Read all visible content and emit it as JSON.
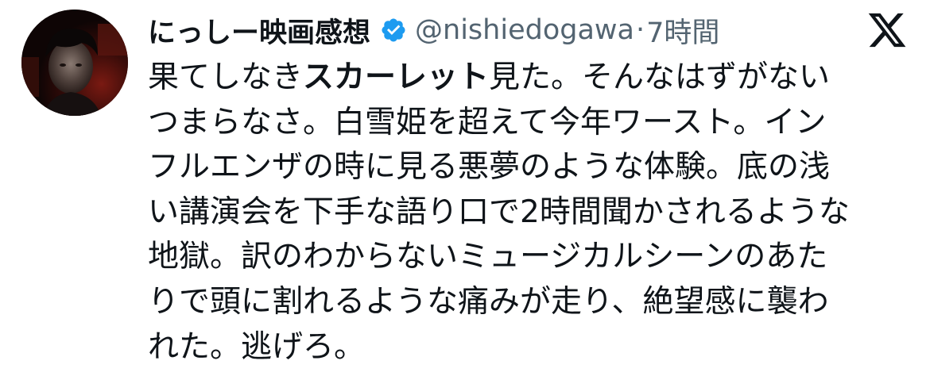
{
  "user": {
    "display_name": "にっしー映画感想",
    "handle": "@nishiedogawa",
    "separator": "·",
    "time": "7時間",
    "verified": true,
    "verified_color": "#1d9bf0"
  },
  "icons": {
    "avatar": "user-avatar",
    "verified": "verified-badge-icon",
    "platform": "x-logo-icon"
  },
  "tweet": {
    "lines": [
      {
        "pre": "果てしなき",
        "bold": "スカーレット",
        "post": "見た。そんなはずがない"
      },
      {
        "pre": "つまらなさ。白雪姫を超えて今年ワースト。イン",
        "bold": "",
        "post": ""
      },
      {
        "pre": "フルエンザの時に見る悪夢のような体験。底の浅",
        "bold": "",
        "post": ""
      },
      {
        "pre": "い講演会を下手な語り口で2時間聞かされるような",
        "bold": "",
        "post": ""
      },
      {
        "pre": "地獄。訳のわからないミュージカルシーンのあた",
        "bold": "",
        "post": ""
      },
      {
        "pre": "りで頭に割れるような痛みが走り、絶望感に襲わ",
        "bold": "",
        "post": ""
      },
      {
        "pre": "れた。逃げろ。",
        "bold": "",
        "post": ""
      }
    ]
  }
}
